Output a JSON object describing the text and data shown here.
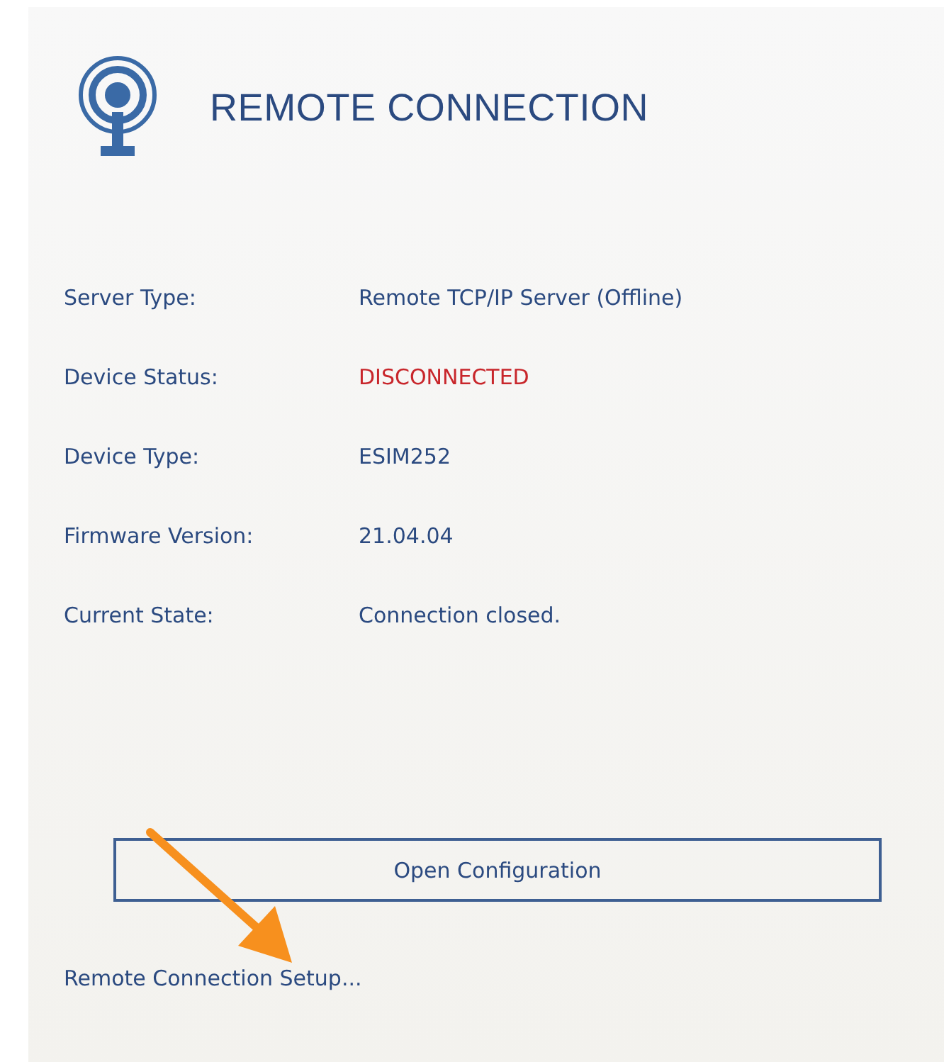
{
  "header": {
    "title": "REMOTE CONNECTION"
  },
  "fields": [
    {
      "label": "Server Type:",
      "value": "Remote TCP/IP Server (Offline)",
      "kind": "normal"
    },
    {
      "label": "Device Status:",
      "value": "DISCONNECTED",
      "kind": "alert"
    },
    {
      "label": "Device Type:",
      "value": "ESIM252",
      "kind": "normal"
    },
    {
      "label": "Firmware Version:",
      "value": "21.04.04",
      "kind": "normal"
    },
    {
      "label": "Current State:",
      "value": "Connection closed.",
      "kind": "normal"
    }
  ],
  "button": {
    "label": "Open Configuration"
  },
  "link": {
    "label": "Remote Connection Setup..."
  }
}
